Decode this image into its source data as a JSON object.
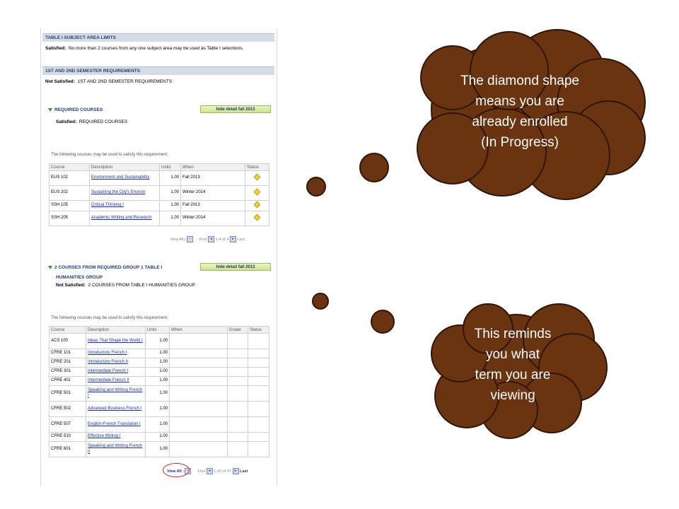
{
  "colors": {
    "cloud_fill": "#6b3410",
    "cloud_stroke": "#2e1606",
    "section_header": "#d4dce8",
    "link": "#1a2fb8",
    "diamond": "#f5d22a",
    "highlight": "#d22222"
  },
  "sections": {
    "table1_header": "TABLE I SUBJECT AREA LIMITS",
    "table1_status": "Satisfied:",
    "table1_text": "No more than 2 courses from any one subject area may be used as Table I selections.",
    "sem_header": "1ST AND 2ND SEMESTER REQUIREMENTS",
    "sem_status": "Not Satisfied:",
    "sem_text": "1ST AND 2ND SEMESTER REQUIREMENTS"
  },
  "req1": {
    "title": "REQUIRED COURSES",
    "button": "hide detail fall 2013",
    "status": "Satisfied:",
    "status_text": "REQUIRED COURSES",
    "caption": "The following courses may be used to satisfy this requirement:",
    "headers": [
      "Course",
      "Description",
      "Units",
      "When",
      "Status"
    ],
    "rows": [
      {
        "course": "EUS 102",
        "desc": "Environment and Sustainability",
        "units": "1.00",
        "when": "Fall 2013",
        "status": "in-progress-diamond"
      },
      {
        "course": "EUS 202",
        "desc": "Sustaining the City's Environ",
        "units": "1.00",
        "when": "Winter 2014",
        "status": "in-progress-diamond"
      },
      {
        "course": "SSH 105",
        "desc": "Critical Thinking I",
        "units": "1.00",
        "when": "Fall 2013",
        "status": "in-progress-diamond"
      },
      {
        "course": "SSH 205",
        "desc": "Academic Writing and Research",
        "units": "1.00",
        "when": "Winter 2014",
        "status": "in-progress-diamond"
      }
    ],
    "pager": {
      "view_all": "View All",
      "first": "First",
      "range": "1-4 of 4",
      "last": "Last"
    }
  },
  "req2": {
    "title": "2 COURSES FROM REQUIRED GROUP 1 TABLE I",
    "subtitle": "HUMANITIES GROUP",
    "button": "hide detail fall 2013",
    "status": "Not Satisfied:",
    "status_text": "2 COURSES FROM TABLE I HUMANITIES GROUP",
    "caption": "The following courses may be used to satisfy this requirement:",
    "headers": [
      "Course",
      "Description",
      "Units",
      "When",
      "Grade",
      "Status"
    ],
    "rows": [
      {
        "course": "ACS 100",
        "desc": "Ideas That Shape the World I",
        "units": "1.00"
      },
      {
        "course": "CFRE 101",
        "desc": "Introductory French I",
        "units": "1.00"
      },
      {
        "course": "CFRE 201",
        "desc": "Introductory French II",
        "units": "1.00"
      },
      {
        "course": "CFRE 301",
        "desc": "Intermediate French I",
        "units": "1.00"
      },
      {
        "course": "CFRE 401",
        "desc": "Intermediate French II",
        "units": "1.00"
      },
      {
        "course": "CFRE 501",
        "desc": "Speaking and Writing French I",
        "units": "1.00"
      },
      {
        "course": "CFRE 502",
        "desc": "Advanced Business French I",
        "units": "1.00"
      },
      {
        "course": "CFRE 507",
        "desc": "English-French Translation I",
        "units": "1.00"
      },
      {
        "course": "CFRE 510",
        "desc": "Effective Writing I",
        "units": "1.00"
      },
      {
        "course": "CFRE 601",
        "desc": "Speaking and Writing French II",
        "units": "1.00"
      }
    ],
    "pager": {
      "view_all": "View All",
      "first": "First",
      "range": "1-10 of 47",
      "last": "Last"
    }
  },
  "callouts": {
    "top": [
      "The diamond shape",
      "means you are",
      "already enrolled",
      "(In Progress)"
    ],
    "bottom": [
      "This reminds",
      "you what",
      "term you are",
      "viewing"
    ]
  }
}
